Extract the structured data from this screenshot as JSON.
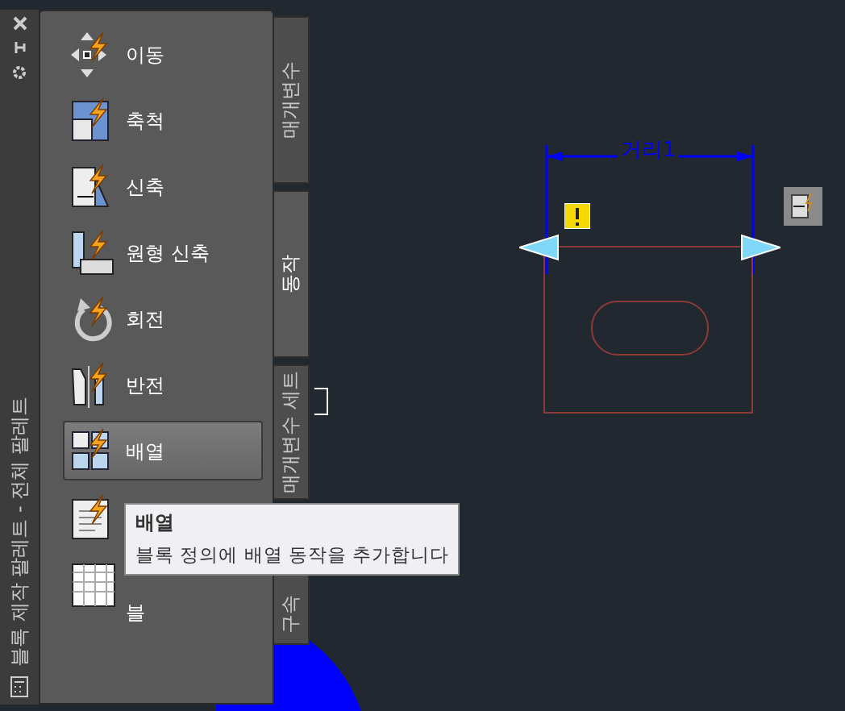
{
  "palette": {
    "title": "블록 제작 팔레트 - 전체 팔레트",
    "items": [
      {
        "kind": "move",
        "label": "이동",
        "selected": false
      },
      {
        "kind": "scale",
        "label": "축척",
        "selected": false
      },
      {
        "kind": "stretch",
        "label": "신축",
        "selected": false
      },
      {
        "kind": "polar",
        "label": "원형 신축",
        "selected": false
      },
      {
        "kind": "rotate",
        "label": "회전",
        "selected": false
      },
      {
        "kind": "flip",
        "label": "반전",
        "selected": false
      },
      {
        "kind": "array",
        "label": "배열",
        "selected": true
      },
      {
        "kind": "lookup",
        "selected": false
      },
      {
        "kind": "table",
        "label": "블",
        "selected": false
      }
    ],
    "tabs": [
      {
        "label": "매개변수",
        "selected": false
      },
      {
        "label": "동작",
        "selected": true
      },
      {
        "label": "매개변수 세트",
        "selected": false
      },
      {
        "label": "구속",
        "selected": false
      }
    ]
  },
  "tooltip": {
    "title": "배열",
    "description": "블록 정의에 배열 동작을 추가합니다"
  },
  "canvas": {
    "dimension_label": "거리1"
  }
}
